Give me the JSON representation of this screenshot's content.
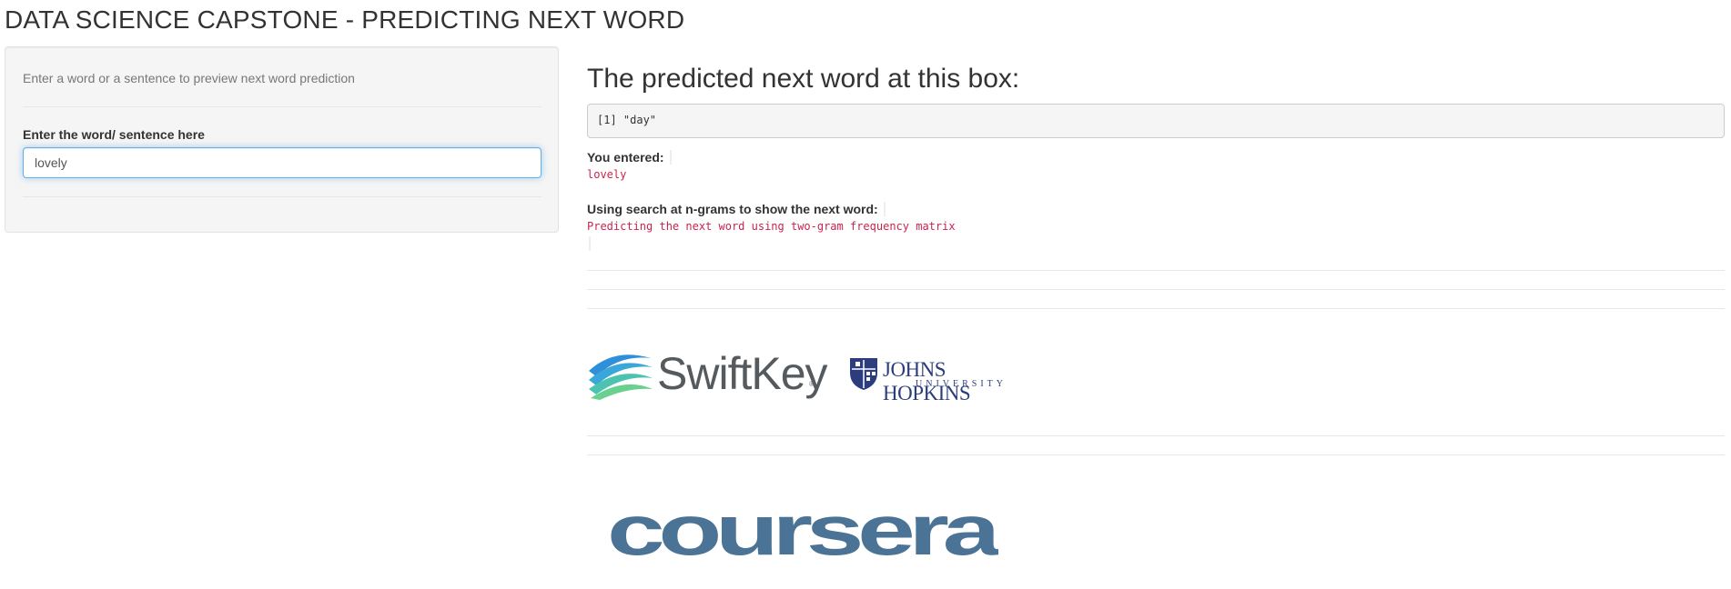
{
  "page": {
    "title": "DATA SCIENCE CAPSTONE - PREDICTING NEXT WORD"
  },
  "sidebar": {
    "hint": "Enter a word or a sentence to preview next word prediction",
    "input_label": "Enter the word/ sentence here",
    "input_value": "lovely"
  },
  "main": {
    "heading": "The predicted next word at this box:",
    "prediction_output": "[1] \"day\"",
    "entered_label": "You entered:",
    "entered_value": "lovely",
    "method_label": "Using search at n-grams to show the next word:",
    "method_value": "Predicting the next word using two-gram frequency matrix"
  },
  "logos": {
    "swiftkey_text": "SwiftKey",
    "swiftkey_reg": "®",
    "jhu_name": "JOHNS HOPKINS",
    "jhu_university": "UNIVERSITY",
    "coursera_text": "coursera"
  },
  "colors": {
    "code_text": "#c7254e",
    "input_focus_border": "#66afe9",
    "jhu_blue": "#2b3d7d",
    "coursera_blue": "#4a7396",
    "swiftkey_gray": "#555a5e"
  }
}
